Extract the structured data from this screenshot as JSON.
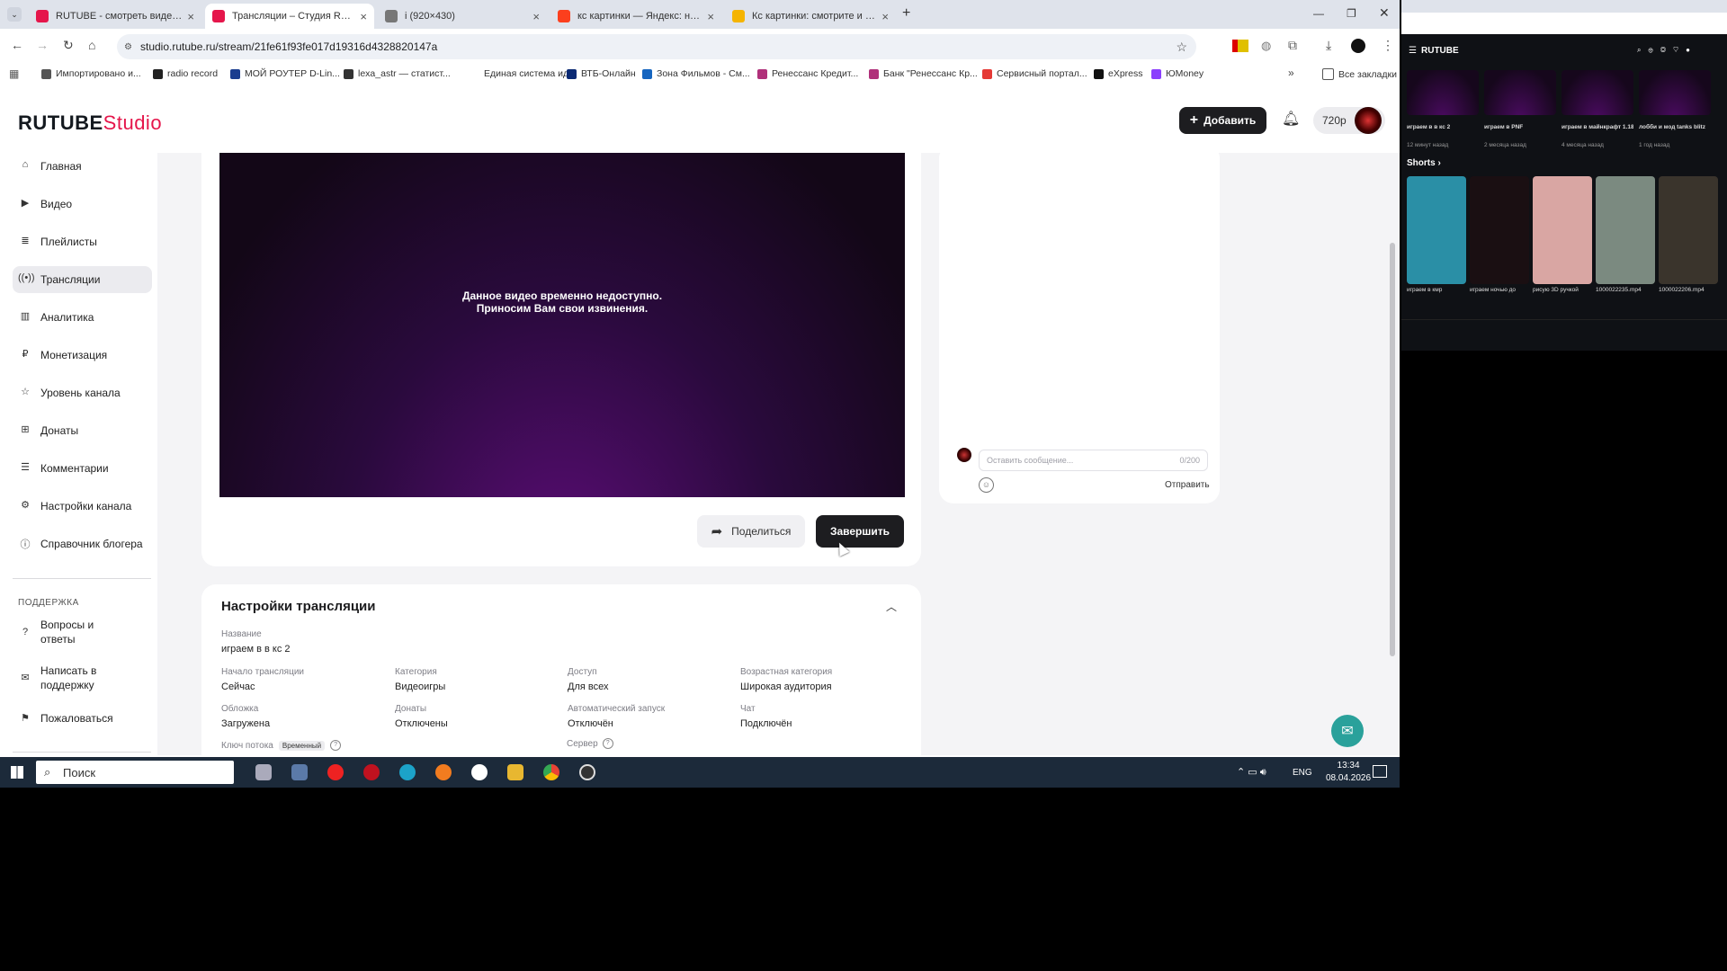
{
  "browser": {
    "tabs": [
      {
        "label": "RUTUBE - смотреть видео он...",
        "active": false,
        "color": "#e5164b"
      },
      {
        "label": "Трансляции – Студия RUTUBE",
        "active": true,
        "color": "#e5164b"
      },
      {
        "label": "i (920×430)",
        "active": false,
        "color": "#777777"
      },
      {
        "label": "кс картинки — Яндекс: нашло...",
        "active": false,
        "color": "#fc3f1d"
      },
      {
        "label": "Кс картинки: смотрите и скач...",
        "active": false,
        "color": "#f5b400"
      }
    ],
    "url": "studio.rutube.ru/stream/21fe61f93fe017d19316d4328820147a",
    "bookmarks": [
      {
        "label": "Импортировано и...",
        "color": "#555555"
      },
      {
        "label": "radio record",
        "color": "#222222"
      },
      {
        "label": "МОЙ РОУТЕР D-Lin...",
        "color": "#1a3d8f"
      },
      {
        "label": "lexa_astr — статист...",
        "color": "#333333"
      },
      {
        "label": "Единая система ид...",
        "color": "#ffffff"
      },
      {
        "label": "ВТБ-Онлайн",
        "color": "#0a2973"
      },
      {
        "label": "Зона Фильмов - См...",
        "color": "#1565c0"
      },
      {
        "label": "Ренессанс Кредит...",
        "color": "#b0307a"
      },
      {
        "label": "Банк \"Ренессанс Кр...",
        "color": "#b0307a"
      },
      {
        "label": "Сервисный портал...",
        "color": "#e53935"
      },
      {
        "label": "eXpress",
        "color": "#111111"
      },
      {
        "label": "ЮMoney",
        "color": "#8b3ffd"
      }
    ],
    "all_bookmarks": "Все закладки",
    "more": "»"
  },
  "app": {
    "logo_main": "RUTUBE",
    "logo_sub": "Studio",
    "add_button": "Добавить",
    "quality": "720р",
    "accent": "#e5164b"
  },
  "sidebar": {
    "items": [
      {
        "label": "Главная",
        "icon": "home-icon",
        "active": false
      },
      {
        "label": "Видео",
        "icon": "video-icon",
        "active": false
      },
      {
        "label": "Плейлисты",
        "icon": "playlist-icon",
        "active": false
      },
      {
        "label": "Трансляции",
        "icon": "broadcast-icon",
        "active": true
      },
      {
        "label": "Аналитика",
        "icon": "analytics-icon",
        "active": false
      },
      {
        "label": "Монетизация",
        "icon": "monetization-icon",
        "active": false
      },
      {
        "label": "Уровень канала",
        "icon": "star-icon",
        "active": false
      },
      {
        "label": "Донаты",
        "icon": "donate-icon",
        "active": false
      },
      {
        "label": "Комментарии",
        "icon": "comments-icon",
        "active": false
      },
      {
        "label": "Настройки канала",
        "icon": "gear-icon",
        "active": false
      },
      {
        "label": "Справочник блогера",
        "icon": "info-icon",
        "active": false
      }
    ],
    "support_title": "ПОДДЕРЖКА",
    "support_items": [
      {
        "label": "Вопросы и ответы",
        "icon": "help-icon"
      },
      {
        "label": "Написать в поддержку",
        "icon": "mail-icon"
      },
      {
        "label": "Пожаловаться",
        "icon": "flag-icon"
      }
    ]
  },
  "player": {
    "message_line1": "Данное видео временно недоступно.",
    "message_line2": "Приносим Вам свои извинения."
  },
  "actions": {
    "share": "Поделиться",
    "finish": "Завершить"
  },
  "chat": {
    "placeholder": "Оставить сообщение...",
    "counter": "0/200",
    "send": "Отправить"
  },
  "settings": {
    "title": "Настройки трансляции",
    "name_label": "Название",
    "name_value": "играем в в кс 2",
    "fields": [
      {
        "label": "Начало трансляции",
        "value": "Сейчас"
      },
      {
        "label": "Категория",
        "value": "Видеоигры"
      },
      {
        "label": "Доступ",
        "value": "Для всех"
      },
      {
        "label": "Возрастная категория",
        "value": "Широкая аудитория"
      },
      {
        "label": "Обложка",
        "value": "Загружена"
      },
      {
        "label": "Донаты",
        "value": "Отключены"
      },
      {
        "label": "Автоматический запуск",
        "value": "Отключён"
      },
      {
        "label": "Чат",
        "value": "Подключён"
      }
    ],
    "stream_key_label": "Ключ потока",
    "stream_key_badge": "Временный",
    "server_label": "Сервер"
  },
  "taskbar": {
    "search": "Поиск",
    "lang": "ENG",
    "time": "13:34",
    "date": "08.04.2026"
  },
  "side_window": {
    "logo": "RUTUBE",
    "shorts_title": "Shorts",
    "top_videos": [
      {
        "title": "играем в в кс 2",
        "meta": "12 минут назад"
      },
      {
        "title": "играем в PNF",
        "meta": "2 месяца назад"
      },
      {
        "title": "играем в майнкрафт 1.18.1",
        "meta": "4 месяца назад"
      },
      {
        "title": "лобби и мод tanks blitz",
        "meta": "1 год назад"
      }
    ],
    "shorts": [
      {
        "title": "играем в кмр",
        "color": "#2a8fa6"
      },
      {
        "title": "играем ночью до",
        "color": "#1a0f12"
      },
      {
        "title": "рисую 3D ручкой",
        "color": "#d9a6a3"
      },
      {
        "title": "1000022235.mp4",
        "color": "#7b8a80"
      },
      {
        "title": "1000022206.mp4",
        "color": "#3a342c"
      }
    ]
  }
}
